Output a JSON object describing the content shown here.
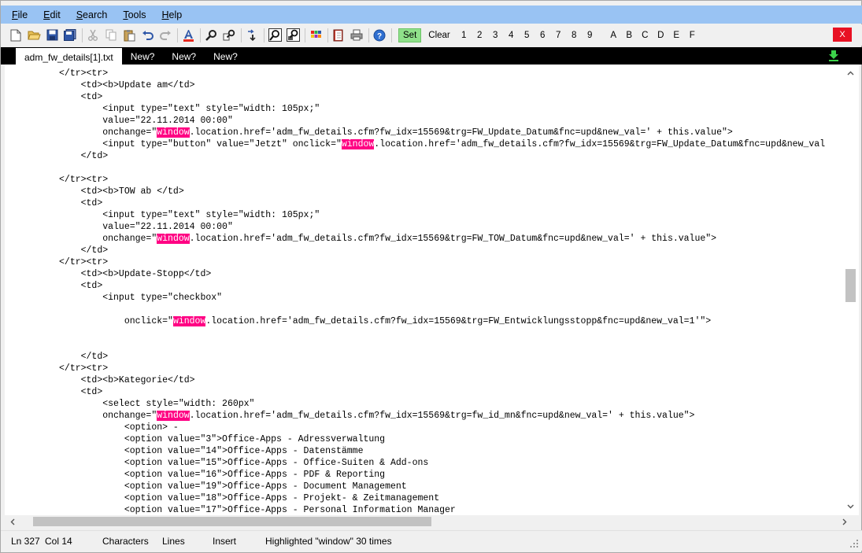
{
  "menu": {
    "items": [
      {
        "first": "F",
        "rest": "ile"
      },
      {
        "first": "E",
        "rest": "dit"
      },
      {
        "first": "S",
        "rest": "earch"
      },
      {
        "first": "T",
        "rest": "ools"
      },
      {
        "first": "H",
        "rest": "elp"
      }
    ]
  },
  "toolbar": {
    "set_label": "Set",
    "clear_label": "Clear",
    "bookmarks": [
      "1",
      "2",
      "3",
      "4",
      "5",
      "6",
      "7",
      "8",
      "9",
      "A",
      "B",
      "C",
      "D",
      "E",
      "F"
    ],
    "close_label": "X"
  },
  "tabs": [
    {
      "label": "adm_fw_details[1].txt",
      "active": true
    },
    {
      "label": "New?",
      "active": false
    },
    {
      "label": "New?",
      "active": false
    },
    {
      "label": "New?",
      "active": false
    }
  ],
  "editor": {
    "highlight_word": "window",
    "highlight_color": "#ff0083",
    "lines": [
      "          </tr><tr>",
      "              <td><b>Update am</td>",
      "              <td>",
      "                  <input type=\"text\" style=\"width: 105px;\"",
      "                  value=\"22.11.2014 00:00\"",
      "                  onchange=\"window.location.href='adm_fw_details.cfm?fw_idx=15569&trg=FW_Update_Datum&fnc=upd&new_val=' + this.value\">",
      "                  <input type=\"button\" value=\"Jetzt\" onclick=\"window.location.href='adm_fw_details.cfm?fw_idx=15569&trg=FW_Update_Datum&fnc=upd&new_val",
      "              </td>",
      "",
      "          </tr><tr>",
      "              <td><b>TOW ab </td>",
      "              <td>",
      "                  <input type=\"text\" style=\"width: 105px;\"",
      "                  value=\"22.11.2014 00:00\"",
      "                  onchange=\"window.location.href='adm_fw_details.cfm?fw_idx=15569&trg=FW_TOW_Datum&fnc=upd&new_val=' + this.value\">",
      "              </td>",
      "          </tr><tr>",
      "              <td><b>Update-Stopp</td>",
      "              <td>",
      "                  <input type=\"checkbox\"",
      "",
      "                      onclick=\"window.location.href='adm_fw_details.cfm?fw_idx=15569&trg=FW_Entwicklungsstopp&fnc=upd&new_val=1'\">",
      "",
      "",
      "              </td>",
      "          </tr><tr>",
      "              <td><b>Kategorie</td>",
      "              <td>",
      "                  <select style=\"width: 260px\"",
      "                  onchange=\"window.location.href='adm_fw_details.cfm?fw_idx=15569&trg=fw_id_mn&fnc=upd&new_val=' + this.value\">",
      "                      <option> -",
      "                      <option value=\"3\">Office-Apps - Adressverwaltung",
      "                      <option value=\"14\">Office-Apps - Datenstämme",
      "                      <option value=\"15\">Office-Apps - Office-Suiten & Add-ons",
      "                      <option value=\"16\">Office-Apps - PDF & Reporting",
      "                      <option value=\"19\">Office-Apps - Document Management",
      "                      <option value=\"18\">Office-Apps - Projekt- & Zeitmanagement",
      "                      <option value=\"17\">Office-Apps - Personal Information Manager"
    ]
  },
  "status": {
    "ln": "Ln 327",
    "col": "Col 14",
    "characters": "Characters",
    "lines": "Lines",
    "mode": "Insert",
    "message": "Highlighted \"window\" 30 times"
  }
}
